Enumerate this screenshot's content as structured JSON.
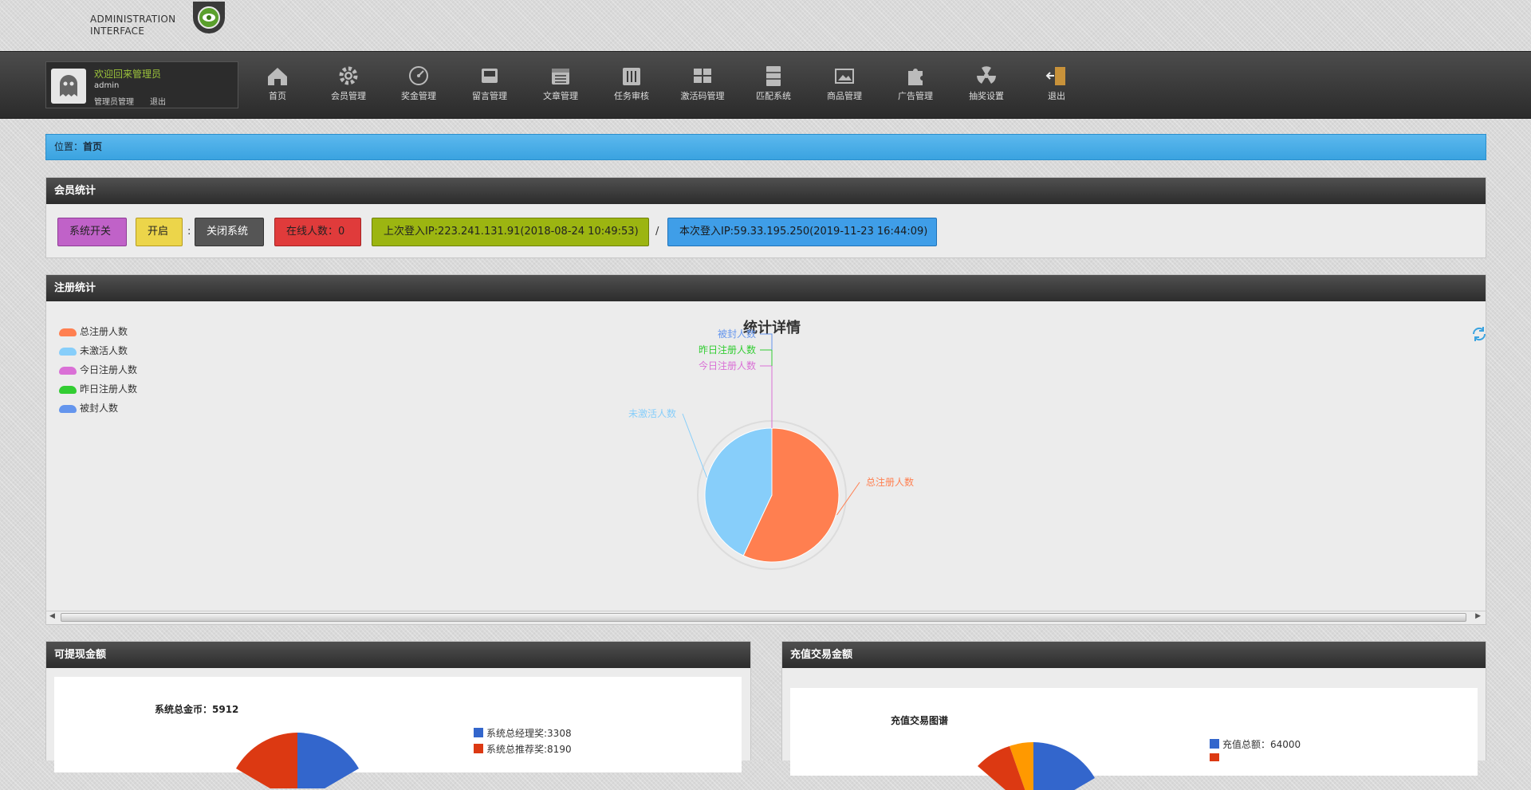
{
  "brand": {
    "line1": "ADMINISTRATION",
    "line2": "INTERFACE"
  },
  "user": {
    "welcome": "欢迎回来管理员",
    "name": "admin",
    "role": "管理员管理",
    "logout": "退出"
  },
  "nav": [
    {
      "label": "首页",
      "icon": "home-icon"
    },
    {
      "label": "会员管理",
      "icon": "gear-icon"
    },
    {
      "label": "奖金管理",
      "icon": "gauge-icon"
    },
    {
      "label": "留言管理",
      "icon": "inbox-icon"
    },
    {
      "label": "文章管理",
      "icon": "calendar-icon"
    },
    {
      "label": "任务审核",
      "icon": "sliders-icon"
    },
    {
      "label": "激活码管理",
      "icon": "grid-icon"
    },
    {
      "label": "匹配系统",
      "icon": "cabinet-icon"
    },
    {
      "label": "商品管理",
      "icon": "image-icon"
    },
    {
      "label": "广告管理",
      "icon": "puzzle-icon"
    },
    {
      "label": "抽奖设置",
      "icon": "radiation-icon"
    },
    {
      "label": "退出",
      "icon": "exit-door-icon"
    }
  ],
  "breadcrumb": {
    "prefix": "位置：",
    "current": "首页"
  },
  "member_panel": {
    "title": "会员统计",
    "switch_label": "系统开关",
    "open_label": "开启",
    "colon": ":",
    "close_label": "关闭系统",
    "online": "在线人数：0",
    "last_login": "上次登入IP:223.241.131.91(2018-08-24 10:49:53)",
    "slash": "/",
    "this_login": "本次登入IP:59.33.195.250(2019-11-23 16:44:09)"
  },
  "reg_panel": {
    "title": "注册统计"
  },
  "colors": {
    "accent_blue": "#3aa3e0",
    "purple": "#c062c8",
    "yellow": "#ecd54a",
    "dark": "#555555",
    "red": "#e03b3b",
    "olive": "#9cb511",
    "blue_btn": "#3f9ee8"
  },
  "chart_data": [
    {
      "type": "pie",
      "title": "统计详情",
      "legend": [
        "总注册人数",
        "未激活人数",
        "今日注册人数",
        "昨日注册人数",
        "被封人数"
      ],
      "legend_colors": [
        "#ff7f50",
        "#87cefa",
        "#da70d6",
        "#32cd32",
        "#6495ed"
      ],
      "series": [
        {
          "name": "总注册人数",
          "value": 57
        },
        {
          "name": "未激活人数",
          "value": 43
        },
        {
          "name": "今日注册人数",
          "value": 0
        },
        {
          "name": "昨日注册人数",
          "value": 0
        },
        {
          "name": "被封人数",
          "value": 0
        }
      ]
    },
    {
      "type": "pie",
      "title": "系统总金币：5912",
      "legend": [
        "系统总经理奖:3308",
        "系统总推荐奖:8190"
      ]
    },
    {
      "type": "pie",
      "title": "充值交易图谱",
      "legend": [
        "充值总额：64000"
      ]
    }
  ],
  "wd_panel": {
    "title": "可提现金额"
  },
  "rc_panel": {
    "title": "充值交易金额"
  }
}
